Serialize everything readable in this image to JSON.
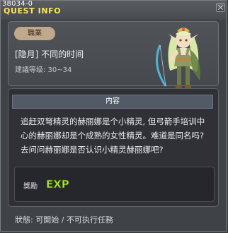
{
  "window": {
    "quest_id": "38034-0",
    "title": "QUEST INFO"
  },
  "quest": {
    "job_tag": "職業",
    "name": "[隐月] 不同的时间",
    "level_text": "建議等级: 30~34"
  },
  "content": {
    "header": "内容",
    "body": "追赶双弩精灵的赫丽娜是个小精灵, 但弓箭手培训中心的赫丽娜却是个成熟的女性精灵。难道是同名吗? 去问问赫丽娜是否认识小精灵赫丽娜吧?"
  },
  "reward": {
    "label": "獎勵",
    "exp_text": "EXP"
  },
  "status": {
    "text": "狀態: 可開始 / 不可执行任務"
  },
  "colors": {
    "title": "#ffe45a",
    "job_tag_bg": "#c0a98a",
    "exp_green": "#b6e83a"
  },
  "icons": {
    "close": "close-icon",
    "npc": "npc-elf-archer-portrait",
    "exp": "exp-icon"
  }
}
